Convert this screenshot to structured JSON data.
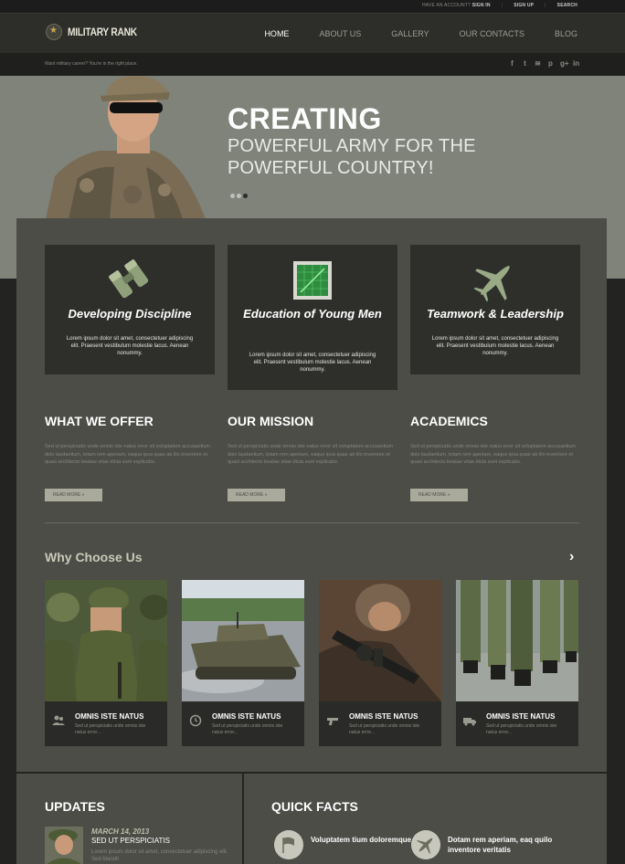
{
  "topbar": {
    "account_prefix": "HAVE AN ACCOUNT?",
    "signin": "SIGN IN",
    "signup": "SIGN UP",
    "search": "SEARCH"
  },
  "header": {
    "logo_text": "Military Rank",
    "nav": [
      "HOME",
      "ABOUT US",
      "GALLERY",
      "OUR CONTACTS",
      "BLOG"
    ],
    "active_nav": "HOME"
  },
  "subbar": {
    "tagline": "Want military career? You're in the right place.",
    "social_icons": [
      "facebook-icon",
      "twitter-icon",
      "rss-icon",
      "pinterest-icon",
      "google-plus-icon",
      "linkedin-icon"
    ],
    "social_glyphs": [
      "f",
      "t",
      "≋",
      "p",
      "g+",
      "in"
    ]
  },
  "hero": {
    "title": "CREATING",
    "subtitle_line1": "POWERFUL ARMY FOR THE",
    "subtitle_line2": "POWERFUL COUNTRY!",
    "slides": 3,
    "active_slide": 3
  },
  "features": [
    {
      "title": "Developing Discipline",
      "icon": "binoculars-icon",
      "text": "Lorem ipsum dolor sit amet, consectetuer adipiscing elit. Praesent vestibulum molestie lacus. Aenean nonummy."
    },
    {
      "title": "Education of Young Men",
      "icon": "radar-icon",
      "text": "Lorem ipsum dolor sit amet, consectetuer adipiscing elit. Praesent vestibulum molestie lacus. Aenean nonummy."
    },
    {
      "title": "Teamwork & Leadership",
      "icon": "jet-icon",
      "text": "Lorem ipsum dolor sit amet, consectetuer adipiscing elit. Praesent vestibulum molestie lacus. Aenean nonummy."
    }
  ],
  "columns": [
    {
      "title": "WHAT WE OFFER",
      "text": "Sed ut perspiciatis unde omnis iste natus error sit voluptatem accusantium dolo laudantium, totam rem aperiam, eaque ipsa quae ab illo inventore et quasi architecto beatae vitae dicta sunt explicabo.",
      "button": "READ MORE »"
    },
    {
      "title": "OUR MISSION",
      "text": "Sed ut perspiciatis unde omnis iste natus error sit voluptatem accusantium dolo laudantium, totam rem aperiam, eaque ipsa quae ab illo inventore et quasi architecto beatae vitae dicta sunt explicabo.",
      "button": "READ MORE »"
    },
    {
      "title": "ACADEMICS",
      "text": "Sed ut perspiciatis unde omnis iste natus error sit voluptatem accusantium dolo laudantium, totam rem aperiam, eaque ipsa quae ab illo inventore et quasi architecto beatae vitae dicta sunt explicabo.",
      "button": "READ MORE »"
    }
  ],
  "why": {
    "title": "Why Choose Us",
    "arrow": "›",
    "cards": [
      {
        "title": "OMNIS ISTE NATUS",
        "icon": "users-icon",
        "text": "Sed ut perspiciatis unde omnis iste natus error..."
      },
      {
        "title": "OMNIS ISTE NATUS",
        "icon": "clock-icon",
        "text": "Sed ut perspiciatis unde omnis iste natus error..."
      },
      {
        "title": "OMNIS ISTE NATUS",
        "icon": "pistol-icon",
        "text": "Sed ut perspiciatis unde omnis iste natus error..."
      },
      {
        "title": "OMNIS ISTE NATUS",
        "icon": "truck-icon",
        "text": "Sed ut perspiciatis unde omnis iste natus error..."
      }
    ]
  },
  "updates": {
    "title": "UPDATES",
    "date": "MARCH 14, 2013",
    "headline": "SED UT PERSPICIATIS",
    "text": "Lorem ipsum dolor sit amet, consectetuer adipiscing elit. Sed blandit"
  },
  "facts": {
    "title": "QUICK FACTS",
    "items": [
      {
        "text": "Voluptatem tium doloremque",
        "icon": "flag-icon"
      },
      {
        "text": "Dotam rem aperiam, eaq quilo inventore veritatis",
        "icon": "plane-icon"
      }
    ]
  },
  "colors": {
    "panel": "#4c4d47",
    "hero_bg": "#7f837a",
    "button": "#a9aa9b"
  }
}
